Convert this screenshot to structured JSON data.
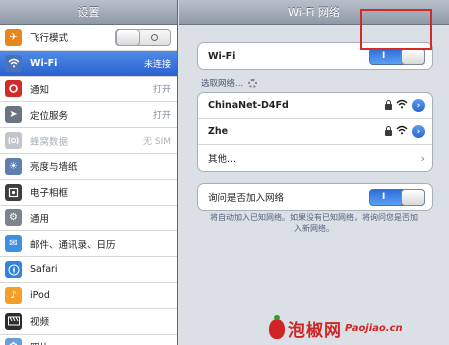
{
  "left": {
    "title": "设置",
    "items": [
      {
        "label": "飞行模式",
        "value": "",
        "icon": "airplane-icon"
      },
      {
        "label": "Wi-Fi",
        "value": "未连接",
        "icon": "wifi-icon"
      },
      {
        "label": "通知",
        "value": "打开",
        "icon": "notifications-icon"
      },
      {
        "label": "定位服务",
        "value": "打开",
        "icon": "location-icon"
      },
      {
        "label": "蜂窝数据",
        "value": "无 SIM",
        "icon": "cellular-icon"
      },
      {
        "label": "亮度与墙纸",
        "value": "",
        "icon": "brightness-icon"
      },
      {
        "label": "电子相框",
        "value": "",
        "icon": "picture-frame-icon"
      },
      {
        "label": "通用",
        "value": "",
        "icon": "gear-icon"
      },
      {
        "label": "邮件、通讯录、日历",
        "value": "",
        "icon": "mail-icon"
      },
      {
        "label": "Safari",
        "value": "",
        "icon": "compass-icon"
      },
      {
        "label": "iPod",
        "value": "",
        "icon": "music-icon"
      },
      {
        "label": "视频",
        "value": "",
        "icon": "film-icon"
      },
      {
        "label": "照片",
        "value": "",
        "icon": "photos-icon"
      }
    ],
    "airplane_mode": "off"
  },
  "right": {
    "title": "Wi-Fi 网络",
    "wifi_label": "Wi-Fi",
    "wifi_toggle_text": "I",
    "choose_label": "选取网络...",
    "networks": [
      {
        "name": "ChinaNet-D4Fd",
        "secured": true
      },
      {
        "name": "Zhe",
        "secured": true
      }
    ],
    "other_label": "其他...",
    "ask_label": "询问是否加入网络",
    "ask_toggle_text": "I",
    "footnote": "将自动加入已知网络。如果没有已知网络，将询问您是否加入新网络。"
  },
  "watermark": {
    "main": "泡椒网",
    "sub": "Paojiao.cn"
  },
  "colors": {
    "accent_blue": "#2a62cf",
    "highlight_red": "#d62a2a"
  }
}
